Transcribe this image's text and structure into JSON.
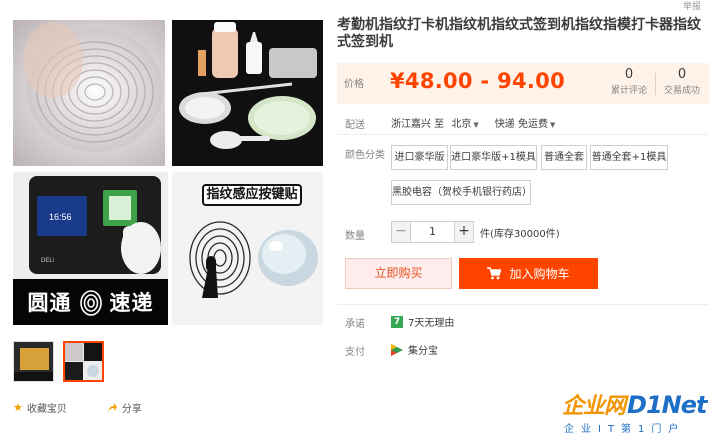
{
  "product": {
    "title": "考勤机指纹打卡机指纹机指纹式签到机指纹指模打卡器指纹式签到机",
    "report_link": "举报"
  },
  "price": {
    "label": "价格",
    "value": "¥48.00 - 94.00",
    "reviews_count": "0",
    "reviews_label": "累计评论",
    "sales_count": "0",
    "sales_label": "交易成功"
  },
  "shipping": {
    "label": "配送",
    "from": "浙江嘉兴 至",
    "to": "北京",
    "method": "快递 免运费"
  },
  "options": {
    "label": "颜色分类",
    "items": [
      "进口豪华版",
      "进口豪华版+1模具",
      "普通全套",
      "普通全套+1模具",
      "黑胶电容（贺校手机银行药店）"
    ],
    "selected_index": -1
  },
  "quantity": {
    "label": "数量",
    "minus": "−",
    "value": "1",
    "plus": "+",
    "stock": "件(库存30000件)"
  },
  "actions": {
    "buy_now": "立即购买",
    "add_to_cart": "加入购物车"
  },
  "guarantee": {
    "label": "承诺",
    "badge": "7",
    "text": "7天无理由"
  },
  "payment": {
    "label": "支付",
    "text": "集分宝"
  },
  "gallery": {
    "sticker_title": "指纹感应按键贴",
    "banner_left": "圆通",
    "banner_right": "速递",
    "device_time": "16:56",
    "device_brand": "DELi"
  },
  "share": {
    "favorite": "收藏宝贝",
    "share": "分享"
  },
  "watermark": {
    "cn": "企业网",
    "en": "D1Net",
    "tagline": "企业IT第1门户"
  },
  "colors": {
    "accent": "#ff4400",
    "price_bg": "#fff2e8",
    "buy_now_bg": "#ffeded"
  }
}
